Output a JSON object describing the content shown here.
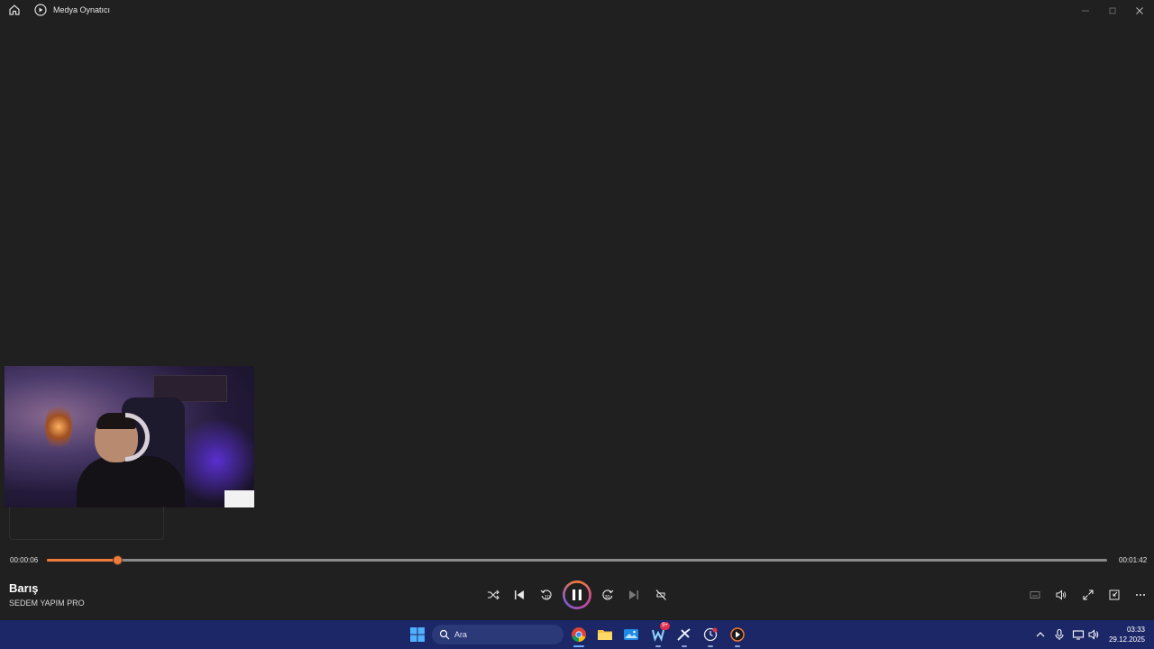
{
  "window": {
    "title": "Medya Oynatıcı"
  },
  "player": {
    "current_time": "00:00:06",
    "duration": "00:01:42",
    "progress": 0.067,
    "track_title": "Barış",
    "artist": "SEDEM YAPIM PRO",
    "state": "playing",
    "accent_color": "#f07a3a"
  },
  "taskbar": {
    "search_placeholder": "Ara",
    "whatsapp_badge": "9+",
    "clock_time": "03:33",
    "clock_date": "29.12.2025",
    "apps": [
      "windows-start",
      "search",
      "chrome",
      "file-explorer",
      "photos",
      "whatsapp",
      "steam",
      "clock",
      "media-player"
    ]
  }
}
